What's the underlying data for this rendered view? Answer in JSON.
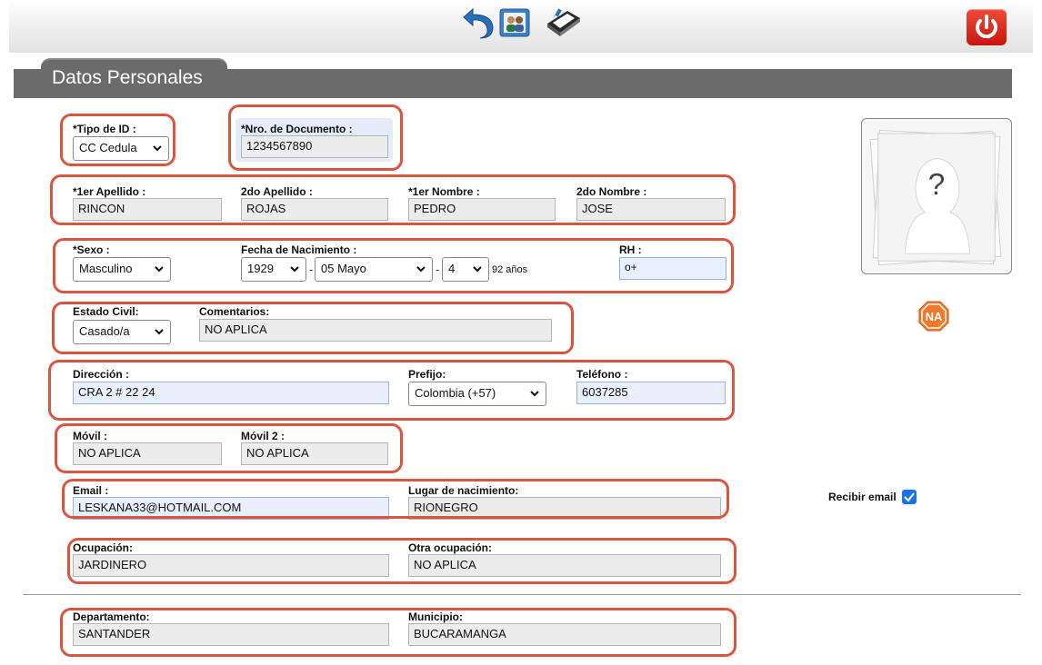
{
  "toolbar": {
    "back_icon": "back-arrow-icon",
    "contacts_icon": "contacts-icon",
    "device_icon": "device-icon",
    "power_icon": "power-icon"
  },
  "section": {
    "title": "Datos Personales"
  },
  "form": {
    "tipo_id": {
      "label": "*Tipo de ID :",
      "value": "CC Cedula"
    },
    "nro_documento": {
      "label": "*Nro. de Documento :",
      "value": "1234567890"
    },
    "apellido1": {
      "label": "*1er Apellido :",
      "value": "RINCON"
    },
    "apellido2": {
      "label": "2do Apellido :",
      "value": "ROJAS"
    },
    "nombre1": {
      "label": "*1er Nombre :",
      "value": "PEDRO"
    },
    "nombre2": {
      "label": "2do Nombre :",
      "value": "JOSE"
    },
    "sexo": {
      "label": "*Sexo :",
      "value": "Masculino"
    },
    "fecha_nacimiento": {
      "label": "Fecha de Nacimiento :",
      "year": "1929",
      "month": "05 Mayo",
      "day": "4",
      "sep": "-",
      "age": "92 años"
    },
    "rh": {
      "label": "RH :",
      "value": "o+"
    },
    "estado_civil": {
      "label": "Estado Civil:",
      "value": "Casado/a"
    },
    "comentarios": {
      "label": "Comentarios:",
      "value": "NO APLICA"
    },
    "direccion": {
      "label": "Dirección :",
      "value": "CRA 2 # 22 24"
    },
    "prefijo": {
      "label": "Prefijo:",
      "value": "Colombia (+57)"
    },
    "telefono": {
      "label": "Teléfono :",
      "value": "6037285"
    },
    "movil": {
      "label": "Móvil :",
      "value": "NO APLICA"
    },
    "movil2": {
      "label": "Móvil 2 :",
      "value": "NO APLICA"
    },
    "email": {
      "label": "Email :",
      "value": "LESKANA33@HOTMAIL.COM"
    },
    "lugar_nacimiento": {
      "label": "Lugar de nacimiento:",
      "value": "RIONEGRO"
    },
    "recibir_email": {
      "label": "Recibir email",
      "checked": true
    },
    "ocupacion": {
      "label": "Ocupación:",
      "value": "JARDINERO"
    },
    "otra_ocupacion": {
      "label": "Otra ocupación:",
      "value": "NO APLICA"
    },
    "departamento": {
      "label": "Departamento:",
      "value": "SANTANDER"
    },
    "municipio": {
      "label": "Municipio:",
      "value": "BUCARAMANGA"
    }
  },
  "photo": {
    "placeholder": "?",
    "badge": "NA"
  },
  "colors": {
    "highlight": "#d9553f",
    "header": "#6b6b6b",
    "accent": "#1a73e8"
  }
}
